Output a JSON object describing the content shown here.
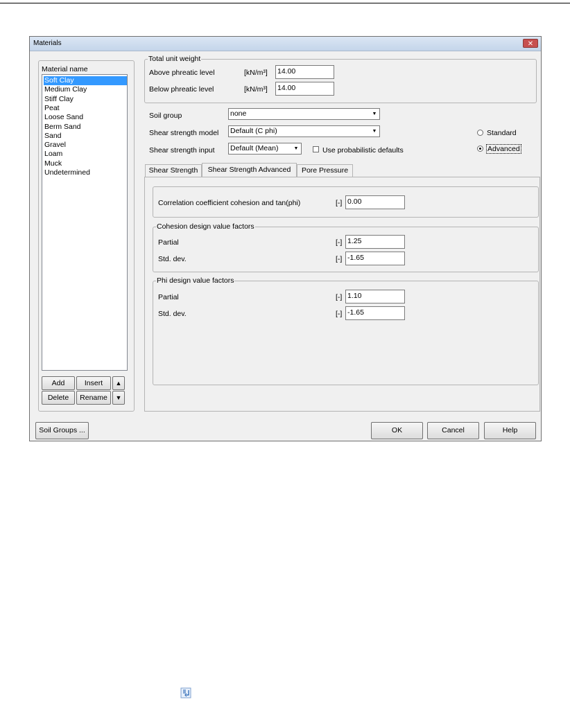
{
  "window": {
    "title": "Materials",
    "close_glyph": "✕"
  },
  "material_list": {
    "label": "Material name",
    "items": [
      "Soft Clay",
      "Medium Clay",
      "Stiff Clay",
      "Peat",
      "Loose Sand",
      "Berm Sand",
      "Sand",
      "Gravel",
      "Loam",
      "Muck",
      "Undetermined"
    ],
    "selected": "Soft Clay",
    "add_label": "Add",
    "insert_label": "Insert",
    "delete_label": "Delete",
    "rename_label": "Rename",
    "up_glyph": "▲",
    "down_glyph": "▼"
  },
  "unit_weight": {
    "title": "Total unit weight",
    "above_label": "Above phreatic level",
    "above_unit": "[kN/m³]",
    "above_value": "14.00",
    "below_label": "Below phreatic level",
    "below_unit": "[kN/m³]",
    "below_value": "14.00"
  },
  "soil": {
    "group_label": "Soil group",
    "group_value": "none",
    "model_label": "Shear strength model",
    "model_value": "Default (C phi)",
    "input_label": "Shear strength input",
    "input_value": "Default (Mean)",
    "probabilistic_label": "Use probabilistic defaults",
    "standard_label": "Standard",
    "advanced_label": "Advanced",
    "selected_mode": "Advanced",
    "dropdown_glyph": "▼"
  },
  "tabs": [
    "Shear Strength",
    "Shear Strength Advanced",
    "Pore Pressure"
  ],
  "active_tab": "Shear Strength Advanced",
  "advanced": {
    "correlation_label": "Correlation coefficient cohesion and tan(phi)",
    "correlation_unit": "[-]",
    "correlation_value": "0.00",
    "cohesion_title": "Cohesion design value factors",
    "cohesion_partial_label": "Partial",
    "cohesion_partial_unit": "[-]",
    "cohesion_partial_value": "1.25",
    "cohesion_std_label": "Std. dev.",
    "cohesion_std_unit": "[-]",
    "cohesion_std_value": "-1.65",
    "phi_title": "Phi design value factors",
    "phi_partial_label": "Partial",
    "phi_partial_unit": "[-]",
    "phi_partial_value": "1.10",
    "phi_std_label": "Std. dev.",
    "phi_std_unit": "[-]",
    "phi_std_value": "-1.65"
  },
  "footer": {
    "soil_groups_label": "Soil Groups ...",
    "ok_label": "OK",
    "cancel_label": "Cancel",
    "help_label": "Help"
  },
  "bottom_icon": "document-arrow-icon"
}
